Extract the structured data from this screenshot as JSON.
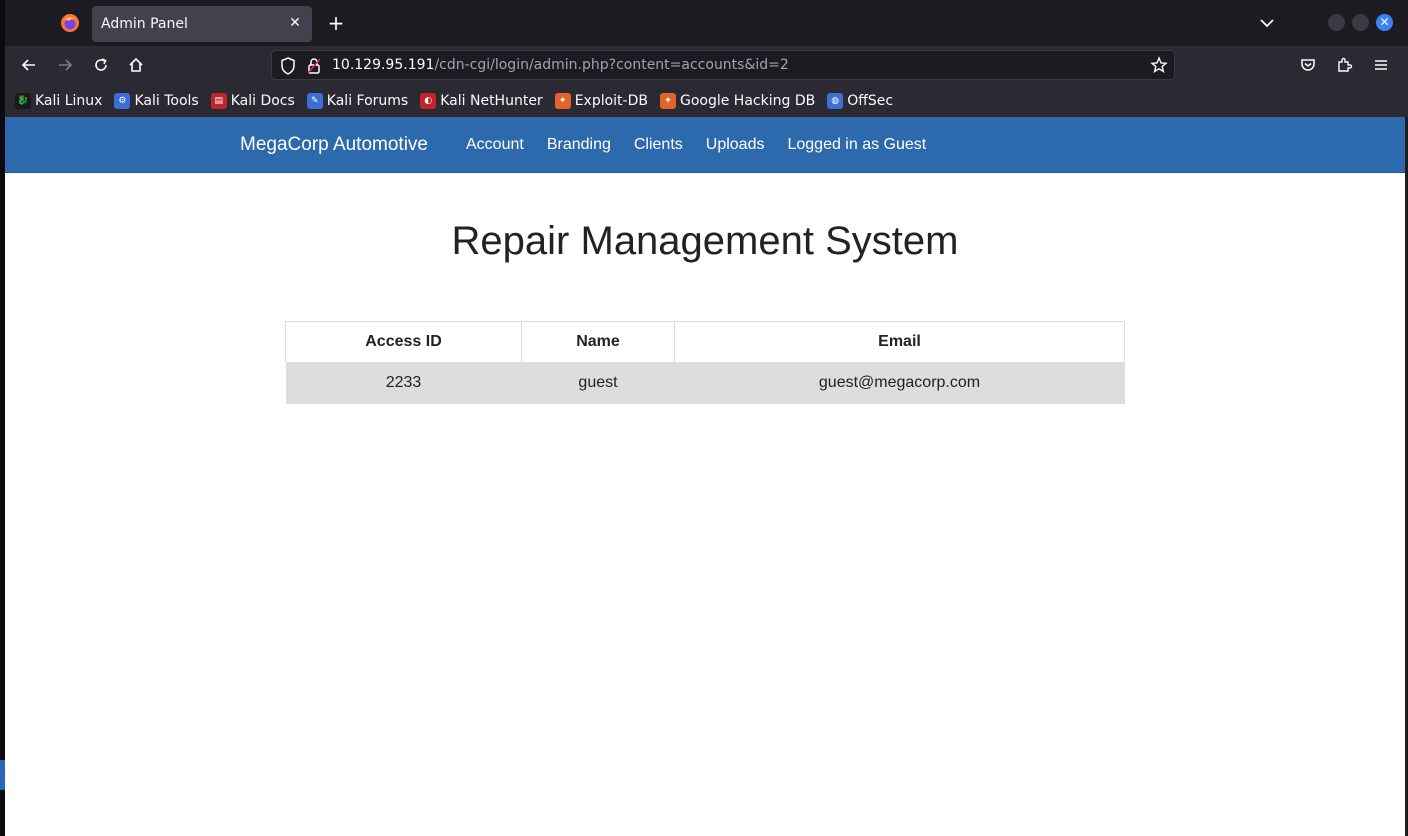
{
  "browser": {
    "tab_title": "Admin Panel",
    "tab_close": "✕",
    "new_tab": "+",
    "url_host": "10.129.95.191",
    "url_path": "/cdn-cgi/login/admin.php?content=accounts&id=2",
    "window_close": "✕",
    "icons": [
      "firefox-logo-icon",
      "back-icon",
      "forward-icon",
      "reload-icon",
      "home-icon",
      "shield-icon",
      "lock-icon",
      "star-icon",
      "pocket-icon",
      "extensions-icon",
      "menu-icon"
    ]
  },
  "bookmarks": [
    {
      "label": "Kali Linux",
      "color": "#1a1a1a"
    },
    {
      "label": "Kali Tools",
      "color": "#3b6fd4"
    },
    {
      "label": "Kali Docs",
      "color": "#c0242c"
    },
    {
      "label": "Kali Forums",
      "color": "#3b6fd4"
    },
    {
      "label": "Kali NetHunter",
      "color": "#c0242c"
    },
    {
      "label": "Exploit-DB",
      "color": "#e0642c"
    },
    {
      "label": "Google Hacking DB",
      "color": "#e0642c"
    },
    {
      "label": "OffSec",
      "color": "#3b6fd4"
    }
  ],
  "site": {
    "brand": "MegaCorp Automotive",
    "nav": [
      "Account",
      "Branding",
      "Clients",
      "Uploads",
      "Logged in as Guest"
    ],
    "nav_color": "#2c6aad",
    "heading": "Repair Management System",
    "table": {
      "headers": [
        "Access ID",
        "Name",
        "Email"
      ],
      "rows": [
        [
          "2233",
          "guest",
          "guest@megacorp.com"
        ]
      ]
    }
  }
}
